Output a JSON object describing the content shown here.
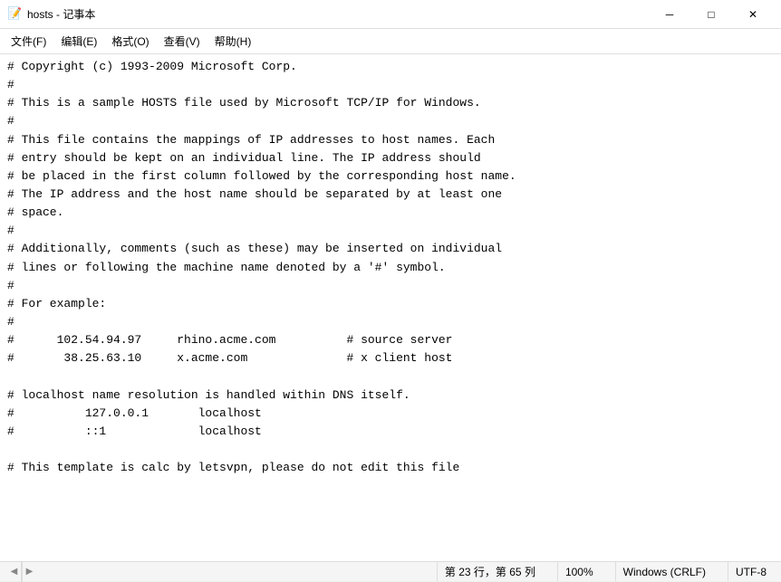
{
  "titleBar": {
    "title": "hosts - 记事本",
    "iconSymbol": "📝",
    "minimizeLabel": "─",
    "maximizeLabel": "□",
    "closeLabel": "✕"
  },
  "menuBar": {
    "items": [
      {
        "label": "文件(F)"
      },
      {
        "label": "编辑(E)"
      },
      {
        "label": "格式(O)"
      },
      {
        "label": "查看(V)"
      },
      {
        "label": "帮助(H)"
      }
    ]
  },
  "content": {
    "lines": [
      "# Copyright (c) 1993-2009 Microsoft Corp.",
      "#",
      "# This is a sample HOSTS file used by Microsoft TCP/IP for Windows.",
      "#",
      "# This file contains the mappings of IP addresses to host names. Each",
      "# entry should be kept on an individual line. The IP address should",
      "# be placed in the first column followed by the corresponding host name.",
      "# The IP address and the host name should be separated by at least one",
      "# space.",
      "#",
      "# Additionally, comments (such as these) may be inserted on individual",
      "# lines or following the machine name denoted by a '#' symbol.",
      "#",
      "# For example:",
      "#",
      "#      102.54.94.97     rhino.acme.com          # source server",
      "#       38.25.63.10     x.acme.com              # x client host",
      "",
      "# localhost name resolution is handled within DNS itself.",
      "#          127.0.0.1       localhost",
      "#          ::1             localhost",
      "",
      "# This template is calc by letsvpn, please do not edit this file"
    ]
  },
  "statusBar": {
    "position": "第 23 行，第 65 列",
    "zoom": "100%",
    "lineEnding": "Windows (CRLF)",
    "encoding": "UTF-8"
  }
}
